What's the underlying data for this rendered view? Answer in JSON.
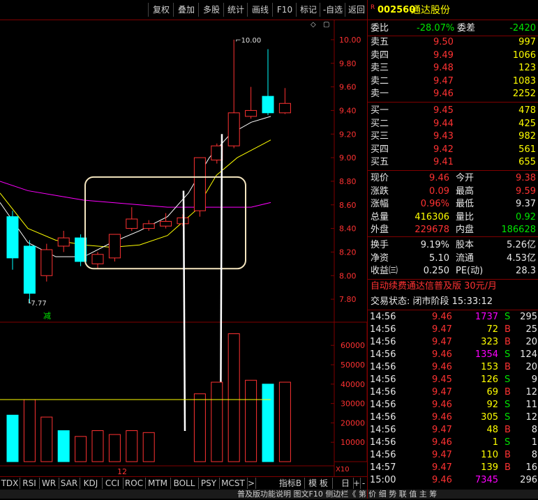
{
  "toolbar": {
    "buttons": [
      "复权",
      "叠加",
      "多股",
      "统计",
      "画线",
      "F10",
      "标记",
      "-自选",
      "返回"
    ]
  },
  "chart": {
    "price_labels": [
      "10.00",
      "9.80",
      "9.60",
      "9.40",
      "9.20",
      "9.00",
      "8.80",
      "8.60",
      "8.40",
      "8.20",
      "8.00",
      "7.80"
    ],
    "high_marker": "10.00",
    "low_marker": "7.77",
    "reduce_badge": "减",
    "volume_labels": [
      "60000",
      "50000",
      "40000",
      "30000",
      "20000",
      "10000"
    ],
    "volume_unit": "X10",
    "date_label": "12",
    "colors": {
      "up": "#ff3232",
      "down": "#00ffff",
      "ma5": "#ffffff",
      "ma10": "#ffff00",
      "ma20": "#ff00ff",
      "box": "#f5e6c0"
    }
  },
  "bottom_tabs": [
    "TDX",
    "RSI",
    "WR",
    "SAR",
    "KDJ",
    "CCI",
    "ROC",
    "MTM",
    "BOLL",
    "PSY",
    "MCST",
    ">",
    "指标B",
    "模 板",
    "日线",
    "+",
    "-"
  ],
  "status_bar": "普及版功能说明 图文F10 侧边栏《 第 价 细 势 联 值 主 筹",
  "quote": {
    "flag": "R",
    "code": "002560",
    "name": "通达股份",
    "wei_bi_label": "委比",
    "wei_bi": "-28.07%",
    "wei_cha_label": "委差",
    "wei_cha": "-2420",
    "asks": [
      {
        "label": "卖五",
        "price": "9.50",
        "vol": "997"
      },
      {
        "label": "卖四",
        "price": "9.49",
        "vol": "1066"
      },
      {
        "label": "卖三",
        "price": "9.48",
        "vol": "123"
      },
      {
        "label": "卖二",
        "price": "9.47",
        "vol": "1083"
      },
      {
        "label": "卖一",
        "price": "9.46",
        "vol": "2252"
      }
    ],
    "bids": [
      {
        "label": "买一",
        "price": "9.45",
        "vol": "478"
      },
      {
        "label": "买二",
        "price": "9.44",
        "vol": "425"
      },
      {
        "label": "买三",
        "price": "9.43",
        "vol": "982"
      },
      {
        "label": "买四",
        "price": "9.42",
        "vol": "561"
      },
      {
        "label": "买五",
        "price": "9.41",
        "vol": "655"
      }
    ],
    "stats": [
      {
        "l1": "现价",
        "v1": "9.46",
        "c1": "red",
        "l2": "今开",
        "v2": "9.38",
        "c2": "red"
      },
      {
        "l1": "涨跌",
        "v1": "0.09",
        "c1": "red",
        "l2": "最高",
        "v2": "9.59",
        "c2": "red"
      },
      {
        "l1": "涨幅",
        "v1": "0.96%",
        "c1": "red",
        "l2": "最低",
        "v2": "9.37",
        "c2": "white"
      },
      {
        "l1": "总量",
        "v1": "416306",
        "c1": "yellow",
        "l2": "量比",
        "v2": "0.92",
        "c2": "green"
      },
      {
        "l1": "外盘",
        "v1": "229678",
        "c1": "red",
        "l2": "内盘",
        "v2": "186628",
        "c2": "green"
      }
    ],
    "stats2": [
      {
        "l1": "换手",
        "v1": "9.19%",
        "l2": "股本",
        "v2": "5.26亿"
      },
      {
        "l1": "净资",
        "v1": "5.10",
        "l2": "流通",
        "v2": "4.53亿"
      },
      {
        "l1": "收益㈢",
        "v1": "0.250",
        "l2": "PE(动)",
        "v2": "28.3"
      }
    ],
    "promo": "自动续费通达信普及版 30元/月",
    "trade_status": "交易状态: 闭市阶段 15:33:12"
  },
  "ticks": [
    {
      "t": "14:56",
      "p": "9.46",
      "pc": "red",
      "v": "1737",
      "vc": "magenta",
      "s": "S",
      "sc": "green",
      "n": "295"
    },
    {
      "t": "14:56",
      "p": "9.47",
      "pc": "red",
      "v": "72",
      "vc": "yellow",
      "s": "B",
      "sc": "red",
      "n": "25"
    },
    {
      "t": "14:56",
      "p": "9.47",
      "pc": "red",
      "v": "323",
      "vc": "yellow",
      "s": "B",
      "sc": "red",
      "n": "20"
    },
    {
      "t": "14:56",
      "p": "9.46",
      "pc": "red",
      "v": "1354",
      "vc": "magenta",
      "s": "S",
      "sc": "green",
      "n": "124"
    },
    {
      "t": "14:56",
      "p": "9.46",
      "pc": "red",
      "v": "153",
      "vc": "yellow",
      "s": "B",
      "sc": "red",
      "n": "20"
    },
    {
      "t": "14:56",
      "p": "9.45",
      "pc": "red",
      "v": "126",
      "vc": "yellow",
      "s": "S",
      "sc": "green",
      "n": "9"
    },
    {
      "t": "14:56",
      "p": "9.47",
      "pc": "red",
      "v": "69",
      "vc": "yellow",
      "s": "B",
      "sc": "red",
      "n": "12"
    },
    {
      "t": "14:56",
      "p": "9.46",
      "pc": "red",
      "v": "92",
      "vc": "yellow",
      "s": "S",
      "sc": "green",
      "n": "11"
    },
    {
      "t": "14:56",
      "p": "9.46",
      "pc": "red",
      "v": "305",
      "vc": "yellow",
      "s": "S",
      "sc": "green",
      "n": "12"
    },
    {
      "t": "14:56",
      "p": "9.47",
      "pc": "red",
      "v": "48",
      "vc": "yellow",
      "s": "B",
      "sc": "red",
      "n": "8"
    },
    {
      "t": "14:56",
      "p": "9.46",
      "pc": "red",
      "v": "1",
      "vc": "yellow",
      "s": "S",
      "sc": "green",
      "n": "1"
    },
    {
      "t": "14:56",
      "p": "9.47",
      "pc": "red",
      "v": "110",
      "vc": "yellow",
      "s": "B",
      "sc": "red",
      "n": "8"
    },
    {
      "t": "14:57",
      "p": "9.47",
      "pc": "red",
      "v": "139",
      "vc": "yellow",
      "s": "B",
      "sc": "red",
      "n": "16"
    },
    {
      "t": "15:00",
      "p": "9.46",
      "pc": "red",
      "v": "7345",
      "vc": "magenta",
      "s": "",
      "sc": "red",
      "n": "296"
    }
  ],
  "chart_data": {
    "type": "candlestick",
    "y_range": [
      7.7,
      10.1
    ],
    "candles": [
      {
        "o": 8.5,
        "h": 8.55,
        "l": 8.05,
        "c": 8.15,
        "dir": "down"
      },
      {
        "o": 7.85,
        "h": 8.3,
        "l": 7.77,
        "c": 8.25,
        "dir": "down"
      },
      {
        "o": 8.0,
        "h": 8.27,
        "l": 7.95,
        "c": 8.22,
        "dir": "up"
      },
      {
        "o": 8.25,
        "h": 8.38,
        "l": 8.2,
        "c": 8.32,
        "dir": "up"
      },
      {
        "o": 8.32,
        "h": 8.35,
        "l": 8.08,
        "c": 8.12,
        "dir": "down"
      },
      {
        "o": 8.1,
        "h": 8.2,
        "l": 8.06,
        "c": 8.18,
        "dir": "up"
      },
      {
        "o": 8.15,
        "h": 8.35,
        "l": 8.12,
        "c": 8.35,
        "dir": "up"
      },
      {
        "o": 8.4,
        "h": 8.58,
        "l": 8.38,
        "c": 8.48,
        "dir": "up"
      },
      {
        "o": 8.4,
        "h": 8.47,
        "l": 8.38,
        "c": 8.44,
        "dir": "up"
      },
      {
        "o": 8.42,
        "h": 8.53,
        "l": 8.4,
        "c": 8.46,
        "dir": "up"
      },
      {
        "o": 8.44,
        "h": 8.52,
        "l": 8.42,
        "c": 8.49,
        "dir": "up"
      },
      {
        "o": 8.55,
        "h": 8.68,
        "l": 8.5,
        "c": 9.0,
        "dir": "up"
      },
      {
        "o": 8.98,
        "h": 9.12,
        "l": 8.95,
        "c": 9.1,
        "dir": "up"
      },
      {
        "o": 9.1,
        "h": 10.0,
        "l": 9.08,
        "c": 9.38,
        "dir": "up"
      },
      {
        "o": 9.35,
        "h": 9.6,
        "l": 9.33,
        "c": 9.4,
        "dir": "up"
      },
      {
        "o": 9.52,
        "h": 9.92,
        "l": 9.36,
        "c": 9.38,
        "dir": "down"
      },
      {
        "o": 9.38,
        "h": 9.59,
        "l": 9.37,
        "c": 9.46,
        "dir": "up"
      }
    ],
    "volume_range": [
      0,
      68000
    ],
    "volumes": [
      {
        "v": 24000,
        "dir": "down"
      },
      {
        "v": 32000,
        "dir": "up"
      },
      {
        "v": 23000,
        "dir": "up"
      },
      {
        "v": 16000,
        "dir": "down"
      },
      {
        "v": 13000,
        "dir": "up"
      },
      {
        "v": 16000,
        "dir": "up"
      },
      {
        "v": 14000,
        "dir": "up"
      },
      {
        "v": 16000,
        "dir": "up"
      },
      {
        "v": 15000,
        "dir": "up"
      },
      {
        "v": 35000,
        "dir": "up"
      },
      {
        "v": 41000,
        "dir": "up"
      },
      {
        "v": 66000,
        "dir": "up"
      },
      {
        "v": 42000,
        "dir": "up"
      },
      {
        "v": 40000,
        "dir": "down"
      },
      {
        "v": 41000,
        "dir": "up"
      }
    ],
    "volume_ma": 32000
  }
}
